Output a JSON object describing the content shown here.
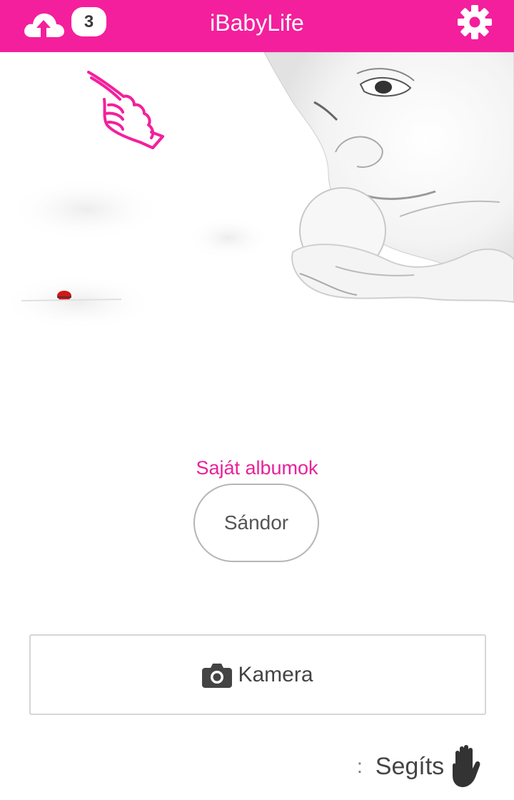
{
  "header": {
    "title": "iBabyLife",
    "upload_icon": "cloud-upload-icon",
    "upload_count": "3",
    "settings_icon": "gear-icon"
  },
  "hero": {
    "description_icon": "pointing-hand-icon"
  },
  "albums": {
    "label": "Saját albumok",
    "items": [
      {
        "label": "Sándor"
      }
    ]
  },
  "camera": {
    "icon": "camera-icon",
    "label": "Kamera"
  },
  "help": {
    "label": "Segíts",
    "icon": "hand-icon"
  },
  "colors": {
    "accent": "#f41f9c",
    "label_pink": "#e8219a"
  }
}
